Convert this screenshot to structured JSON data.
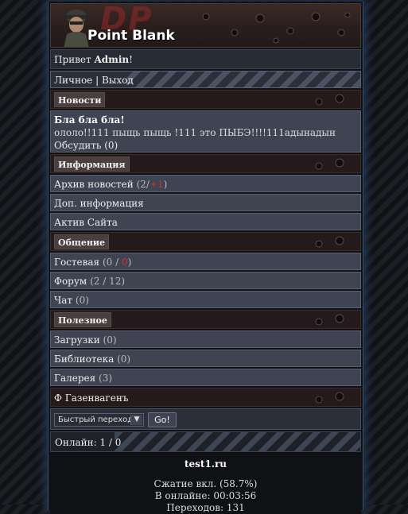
{
  "header": {
    "logo_letters": "DP",
    "brand": "Point Blank"
  },
  "greeting": {
    "prefix": "Привет ",
    "user": "Admin",
    "suffix": "!"
  },
  "user_links": {
    "personal": "Личное",
    "sep": " | ",
    "logout": "Выход"
  },
  "news_section": {
    "title": "Новости",
    "item_title": "Бла бла бла!",
    "item_text": "ололо!!111 пыщь пыщь !111 это ПЫБЭ!!!!111адынадын",
    "discuss_label": "Обсудить",
    "discuss_count": "(0)"
  },
  "info_section": {
    "title": "Информация",
    "items": [
      {
        "label": "Архив новостей",
        "count_prefix": "(2/",
        "count_red": "+1",
        "count_suffix": ")"
      },
      {
        "label": "Доп. информация"
      },
      {
        "label": "Актив Сайта"
      }
    ]
  },
  "social_section": {
    "title": "Общение",
    "guestbook": {
      "label": "Гостевая",
      "count_prefix": "(0 / ",
      "count_red": "0",
      "count_suffix": ")"
    },
    "forum": {
      "label": "Форум",
      "count": "(2 / 12)"
    },
    "chat": {
      "label": "Чат",
      "count": "(0)"
    }
  },
  "useful_section": {
    "title": "Полезное",
    "downloads": {
      "label": "Загрузки",
      "count": "(0)"
    },
    "library": {
      "label": "Библиотека",
      "count": "(0)"
    },
    "gallery": {
      "label": "Галерея",
      "count": "(3)"
    }
  },
  "special_link": "Ф Газенвагенъ",
  "quick_jump": {
    "selected": "Быстрый переход",
    "button": "Go!"
  },
  "online": "Онлайн: 1 / 0",
  "footer": {
    "site": "test1.ru",
    "compression": "Сжатие вкл. (58.7%)",
    "online_time": "В онлайне: 00:03:56",
    "transitions": "Переходов: 131"
  }
}
